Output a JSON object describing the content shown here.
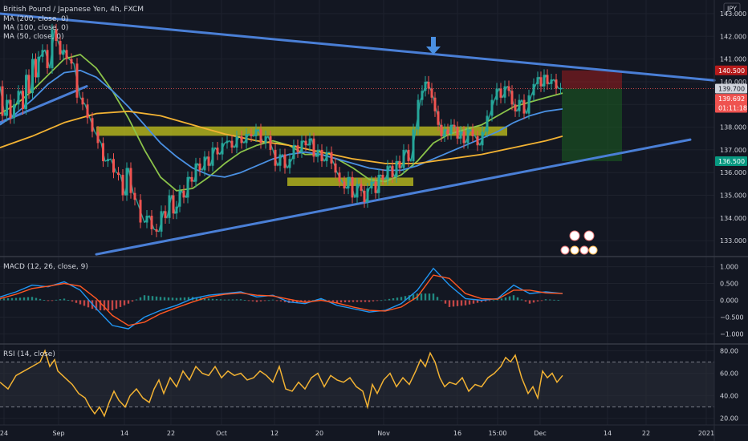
{
  "chart_data": {
    "type": "line",
    "title": "British Pound / Japanese Yen, 4h, FXCM",
    "currency": "JPY",
    "price_panel": {
      "ylim": [
        132.3,
        143.6
      ],
      "y_ticks": [
        133,
        134,
        135,
        136,
        137,
        138,
        139,
        140,
        141,
        142,
        143
      ],
      "legend": [
        "MA (200, close, 0)",
        "MA (100, close, 0)",
        "MA (50, close, 0)"
      ],
      "price_tags": [
        {
          "text": "140.500",
          "value": 140.5,
          "color": "#b71c1c"
        },
        {
          "text": "139.700",
          "value": 139.7,
          "color": "#d1d4dc"
        },
        {
          "text": "139.692",
          "value": 139.25,
          "color": "#ef5350"
        },
        {
          "text": "01:11:18",
          "value": 138.85,
          "color": "#ef5350"
        },
        {
          "text": "136.500",
          "value": 136.5,
          "color": "#089981"
        }
      ],
      "series": [
        {
          "name": "Price",
          "color": "#26a69a",
          "x": [
            0,
            6,
            11,
            15,
            20,
            26,
            31,
            34,
            38,
            43,
            46,
            50,
            56,
            62,
            68,
            72,
            78,
            80,
            86,
            92,
            100,
            106,
            112,
            118,
            126,
            131,
            138,
            145,
            150,
            156,
            160,
            166,
            170,
            180,
            186,
            192,
            198,
            204,
            208,
            214,
            218,
            222,
            226,
            232,
            236,
            242,
            246,
            252,
            258,
            262,
            268,
            274,
            280,
            286,
            292,
            298,
            304,
            310,
            316,
            322,
            328,
            334,
            340,
            346,
            352,
            358,
            364,
            368,
            374,
            378,
            384,
            388,
            394,
            398,
            404,
            410,
            416,
            420,
            426,
            432,
            436,
            442,
            448,
            452,
            456,
            460,
            466,
            470,
            474,
            480,
            486,
            492,
            496,
            500,
            506,
            512,
            518,
            524,
            528,
            532,
            536,
            540,
            544,
            548,
            552,
            556,
            560,
            564,
            568,
            572,
            576,
            580,
            586,
            592,
            598,
            604,
            610,
            616,
            622,
            626,
            632,
            636,
            640,
            644,
            650,
            656,
            662,
            668,
            672,
            676,
            680,
            684,
            690,
            696,
            701
          ],
          "y": [
            139.8,
            138.5,
            139.2,
            138.4,
            139.0,
            139.6,
            138.8,
            140.3,
            139.5,
            141.0,
            140.2,
            141.1,
            141.4,
            140.6,
            142.3,
            141.8,
            141.2,
            141.4,
            141.0,
            140.8,
            139.3,
            139.0,
            138.4,
            137.8,
            137.3,
            136.5,
            136.6,
            136.0,
            135.9,
            135.0,
            136.2,
            135.1,
            134.8,
            133.8,
            134.1,
            133.5,
            133.4,
            134.3,
            134.0,
            135.0,
            134.2,
            134.5,
            135.2,
            134.9,
            135.8,
            135.6,
            136.4,
            136.1,
            136.7,
            136.3,
            137.1,
            136.8,
            137.3,
            137.4,
            137.1,
            137.6,
            137.3,
            137.7,
            137.6,
            137.9,
            137.3,
            137.6,
            137.0,
            136.3,
            136.8,
            136.2,
            136.6,
            137.2,
            136.9,
            137.4,
            137.2,
            137.5,
            136.7,
            137.0,
            136.5,
            136.9,
            136.4,
            136.0,
            135.6,
            135.3,
            135.8,
            134.9,
            135.5,
            135.2,
            134.7,
            135.3,
            135.6,
            135.1,
            135.9,
            135.7,
            136.3,
            135.8,
            136.5,
            136.2,
            137.0,
            136.5,
            137.9,
            139.2,
            139.6,
            140.0,
            139.7,
            139.3,
            138.7,
            138.1,
            137.6,
            137.9,
            137.7,
            138.1,
            138.0,
            137.5,
            137.8,
            137.3,
            137.9,
            137.6,
            137.2,
            137.8,
            138.5,
            139.2,
            139.7,
            139.3,
            139.8,
            139.6,
            139.0,
            138.7,
            139.2,
            138.6,
            139.4,
            139.9,
            140.2,
            139.8,
            140.3,
            139.9,
            140.1,
            139.7,
            139.7
          ]
        },
        {
          "name": "MA (50, close, 0)",
          "color": "#8bc34a",
          "x": [
            0,
            20,
            40,
            60,
            80,
            100,
            120,
            140,
            160,
            180,
            200,
            220,
            240,
            260,
            280,
            300,
            320,
            340,
            360,
            380,
            400,
            420,
            440,
            460,
            480,
            500,
            520,
            540,
            560,
            580,
            600,
            620,
            640,
            660,
            680,
            701
          ],
          "y": [
            138.6,
            139.0,
            139.6,
            140.3,
            141.0,
            141.2,
            140.6,
            139.6,
            138.4,
            137.0,
            135.8,
            135.2,
            135.3,
            135.8,
            136.4,
            136.9,
            137.2,
            137.4,
            137.2,
            136.8,
            136.8,
            136.6,
            136.2,
            135.7,
            135.6,
            135.9,
            136.5,
            137.3,
            137.7,
            137.9,
            138.1,
            138.5,
            138.9,
            139.1,
            139.3,
            139.5
          ]
        },
        {
          "name": "MA (100, close, 0)",
          "color": "#4a90e2",
          "x": [
            0,
            20,
            40,
            60,
            80,
            100,
            120,
            140,
            160,
            180,
            200,
            220,
            240,
            260,
            280,
            300,
            320,
            340,
            360,
            380,
            400,
            420,
            440,
            460,
            480,
            500,
            520,
            540,
            560,
            580,
            600,
            620,
            640,
            660,
            680,
            701
          ],
          "y": [
            138.1,
            138.6,
            139.2,
            139.9,
            140.4,
            140.5,
            140.2,
            139.6,
            138.9,
            138.1,
            137.3,
            136.7,
            136.2,
            135.9,
            135.8,
            136.0,
            136.3,
            136.6,
            136.8,
            136.9,
            136.8,
            136.6,
            136.4,
            136.2,
            136.1,
            136.1,
            136.3,
            136.6,
            136.9,
            137.2,
            137.5,
            137.8,
            138.2,
            138.5,
            138.7,
            138.8
          ]
        },
        {
          "name": "MA (200, close, 0)",
          "color": "#f2b233",
          "x": [
            0,
            40,
            80,
            120,
            160,
            200,
            240,
            280,
            320,
            360,
            400,
            440,
            480,
            520,
            560,
            600,
            640,
            680,
            701
          ],
          "y": [
            137.1,
            137.6,
            138.2,
            138.6,
            138.7,
            138.5,
            138.1,
            137.7,
            137.4,
            137.2,
            136.9,
            136.6,
            136.4,
            136.4,
            136.6,
            136.8,
            137.1,
            137.4,
            137.6
          ]
        }
      ],
      "trendlines": [
        {
          "name": "upper-trendline",
          "x": [
            0,
            890
          ],
          "y": [
            143.0,
            140.06
          ]
        },
        {
          "name": "lower-trendline",
          "x": [
            120,
            860
          ],
          "y": [
            132.4,
            137.45
          ]
        },
        {
          "name": "left-channel",
          "x": [
            0,
            108
          ],
          "y": [
            138.2,
            139.8
          ]
        }
      ],
      "zones": [
        {
          "name": "resistance-zone",
          "x": [
            120,
            632
          ],
          "y": [
            137.62,
            138.03
          ]
        },
        {
          "name": "support-zone",
          "x": [
            358,
            515
          ],
          "y": [
            135.41,
            135.78
          ]
        }
      ],
      "position": {
        "x": [
          700,
          775
        ],
        "entry": 139.7,
        "stop": 140.5,
        "target": 136.5
      },
      "arrow": {
        "x": 540,
        "y": 141.2
      }
    },
    "macd_panel": {
      "legend": "MACD (12, 26, close, 9)",
      "ylim": [
        -1.3,
        1.3
      ],
      "y_ticks": [
        {
          "text": "1.000",
          "value": 1.0
        },
        {
          "text": "0.500",
          "value": 0.5
        },
        {
          "text": "0.000",
          "value": 0.0
        },
        {
          "text": "−0.500",
          "value": -0.5
        },
        {
          "text": "−1.000",
          "value": -1.0
        }
      ],
      "series": [
        {
          "name": "MACD",
          "color": "#2196f3",
          "x": [
            0,
            20,
            40,
            60,
            80,
            100,
            120,
            140,
            160,
            180,
            200,
            220,
            240,
            260,
            280,
            300,
            320,
            340,
            360,
            380,
            400,
            420,
            440,
            460,
            480,
            500,
            520,
            540,
            560,
            580,
            600,
            620,
            640,
            660,
            680,
            701
          ],
          "y": [
            0.1,
            0.25,
            0.45,
            0.4,
            0.55,
            0.3,
            -0.25,
            -0.75,
            -0.85,
            -0.5,
            -0.3,
            -0.15,
            0.05,
            0.15,
            0.2,
            0.25,
            0.1,
            0.15,
            -0.05,
            -0.1,
            0.05,
            -0.15,
            -0.25,
            -0.35,
            -0.3,
            -0.1,
            0.3,
            0.95,
            0.45,
            0.05,
            0.0,
            0.05,
            0.45,
            0.2,
            0.25,
            0.2
          ]
        },
        {
          "name": "Signal",
          "color": "#ff5722",
          "x": [
            0,
            20,
            40,
            60,
            80,
            100,
            120,
            140,
            160,
            180,
            200,
            220,
            240,
            260,
            280,
            300,
            320,
            340,
            360,
            380,
            400,
            420,
            440,
            460,
            480,
            500,
            520,
            540,
            560,
            580,
            600,
            620,
            640,
            660,
            680,
            701
          ],
          "y": [
            0.05,
            0.18,
            0.35,
            0.42,
            0.5,
            0.42,
            0.05,
            -0.45,
            -0.75,
            -0.65,
            -0.4,
            -0.22,
            -0.05,
            0.1,
            0.18,
            0.22,
            0.15,
            0.13,
            0.03,
            -0.06,
            0.0,
            -0.08,
            -0.2,
            -0.3,
            -0.32,
            -0.2,
            0.1,
            0.75,
            0.65,
            0.2,
            0.05,
            0.03,
            0.3,
            0.3,
            0.22,
            0.2
          ]
        }
      ]
    },
    "rsi_panel": {
      "legend": "RSI (14, close)",
      "ylim": [
        14,
        86
      ],
      "y_ticks": [
        {
          "text": "80.00",
          "value": 80
        },
        {
          "text": "60.00",
          "value": 60
        },
        {
          "text": "40.00",
          "value": 40
        },
        {
          "text": "20.00",
          "value": 20
        }
      ],
      "bands": [
        70,
        30
      ],
      "series": [
        {
          "name": "RSI",
          "color": "#f2b233",
          "x": [
            0,
            10,
            20,
            30,
            40,
            50,
            56,
            62,
            68,
            72,
            78,
            84,
            90,
            98,
            106,
            112,
            118,
            124,
            130,
            136,
            142,
            148,
            156,
            162,
            170,
            178,
            186,
            192,
            198,
            204,
            212,
            220,
            228,
            236,
            244,
            252,
            260,
            268,
            276,
            284,
            292,
            300,
            308,
            316,
            324,
            332,
            340,
            348,
            356,
            364,
            372,
            380,
            388,
            396,
            404,
            412,
            420,
            428,
            436,
            444,
            452,
            458,
            464,
            470,
            478,
            486,
            494,
            502,
            510,
            518,
            524,
            530,
            536,
            542,
            548,
            554,
            560,
            568,
            576,
            584,
            592,
            600,
            608,
            616,
            624,
            630,
            636,
            642,
            650,
            658,
            664,
            670,
            676,
            682,
            688,
            694,
            701
          ],
          "y": [
            52,
            46,
            58,
            62,
            66,
            70,
            80,
            66,
            72,
            62,
            58,
            54,
            50,
            42,
            38,
            30,
            24,
            30,
            22,
            34,
            44,
            36,
            30,
            40,
            46,
            38,
            34,
            46,
            54,
            42,
            56,
            48,
            62,
            54,
            66,
            60,
            58,
            66,
            56,
            62,
            58,
            60,
            54,
            56,
            62,
            58,
            52,
            66,
            46,
            44,
            52,
            46,
            56,
            60,
            48,
            58,
            54,
            52,
            56,
            48,
            44,
            30,
            50,
            42,
            54,
            60,
            48,
            56,
            50,
            62,
            72,
            66,
            78,
            70,
            56,
            48,
            52,
            50,
            56,
            44,
            50,
            48,
            56,
            60,
            66,
            74,
            70,
            76,
            56,
            42,
            48,
            38,
            62,
            56,
            60,
            52,
            58
          ]
        }
      ]
    },
    "x_ticks": [
      {
        "text": "24",
        "x": 5
      },
      {
        "text": "Sep",
        "x": 73
      },
      {
        "text": "14",
        "x": 155
      },
      {
        "text": "22",
        "x": 213
      },
      {
        "text": "Oct",
        "x": 276
      },
      {
        "text": "12",
        "x": 342
      },
      {
        "text": "20",
        "x": 398
      },
      {
        "text": "Nov",
        "x": 478
      },
      {
        "text": "16",
        "x": 570
      },
      {
        "text": "15:00",
        "x": 620
      },
      {
        "text": "Dec",
        "x": 673
      },
      {
        "text": "14",
        "x": 757
      },
      {
        "text": "22",
        "x": 805
      },
      {
        "text": "2021",
        "x": 880
      }
    ]
  }
}
